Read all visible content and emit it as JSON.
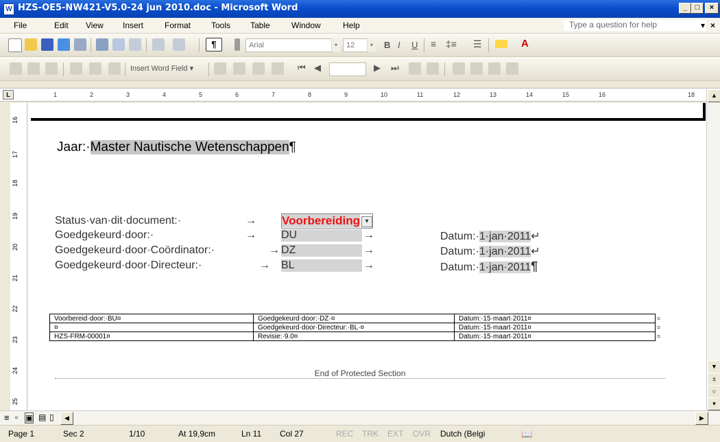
{
  "window": {
    "title": "HZS-OE5-NW421-V5.0-24 jun 2010.doc - Microsoft Word",
    "app_icon": "W"
  },
  "menu": [
    "File",
    "Edit",
    "View",
    "Insert",
    "Format",
    "Tools",
    "Table",
    "Window",
    "Help"
  ],
  "help_placeholder": "Type a question for help",
  "toolbar": {
    "style_pilcrow": "¶",
    "font_name": "Arial",
    "font_size": "12",
    "insert_word_field": "Insert Word Field ▾"
  },
  "ruler_ticks": [
    "1",
    "2",
    "3",
    "4",
    "5",
    "6",
    "7",
    "8",
    "9",
    "10",
    "11",
    "12",
    "13",
    "14",
    "15",
    "16",
    "18"
  ],
  "vruler_ticks": [
    "16",
    "17",
    "18",
    "19",
    "20",
    "21",
    "22",
    "23",
    "24",
    "25"
  ],
  "document": {
    "jaar_label": "Jaar:·",
    "jaar_value": "Master Nautische Wetenschappen",
    "jaar_pilcrow": "¶",
    "rows": [
      {
        "label": "Status·van·dit·document:·",
        "arrow": "→",
        "value": "Voorbereiding",
        "value_red": true,
        "dropdown": true,
        "datum_label": "",
        "datum": "",
        "end": ""
      },
      {
        "label": "Goedgekeurd·door:·",
        "arrow": "→",
        "value": "DU",
        "arrow2": "→",
        "datum_label": "Datum:·",
        "datum": "1·jan·2011",
        "end": "↵"
      },
      {
        "label": "Goedgekeurd·door·Coördinator:·",
        "arrow": "→",
        "value": "DZ",
        "arrow2": "→",
        "datum_label": "Datum:·",
        "datum": "1·jan·2011",
        "end": "↵"
      },
      {
        "label": "Goedgekeurd·door·Directeur:·",
        "arrow": "→",
        "value": "BL",
        "arrow2": "→",
        "datum_label": "Datum:·",
        "datum": "1·jan·2011",
        "end": "¶"
      }
    ],
    "footer_table": [
      [
        "Voorbereid·door:·BU¤",
        "Goedgekeurd·door:·DZ·¤",
        "Datum:·15·maart·2011¤"
      ],
      [
        "¤",
        "Goedgekeurd·door·Directeur:·BL·¤",
        "Datum:·15·maart·2011¤"
      ],
      [
        "HZS-FRM-00001¤",
        "Revisie:·9.0¤",
        "Datum:·15·maart·2011¤"
      ]
    ],
    "row_end_marks": [
      "¤",
      "¤",
      "¤"
    ],
    "end_section": "End of Protected Section"
  },
  "status_bar": {
    "page": "Page 1",
    "sec": "Sec 2",
    "pages": "1/10",
    "at": "At 19,9cm",
    "ln": "Ln 11",
    "col": "Col 27",
    "rec": "REC",
    "trk": "TRK",
    "ext": "EXT",
    "ovr": "OVR",
    "language": "Dutch (Belgi"
  }
}
